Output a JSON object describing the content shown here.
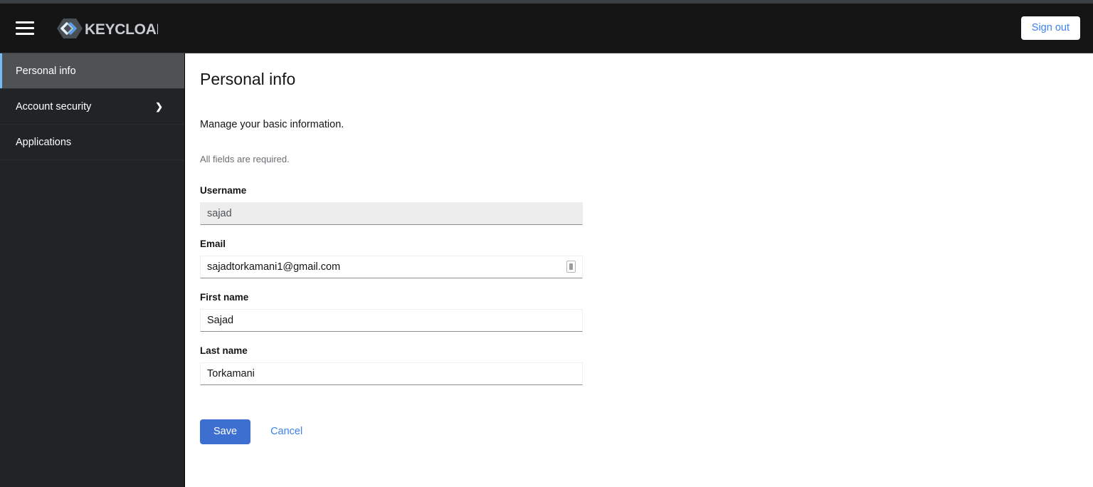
{
  "brand": {
    "name": "KEYCLOAK",
    "logo_hex_color": "#4a4f54",
    "logo_chevron_color": "#57a0e8",
    "logo_chevron_light": "#e8f3fc"
  },
  "masthead": {
    "menu_icon": "hamburger-icon",
    "sign_out_label": "Sign out",
    "background": "#151515",
    "sign_out_text_color": "#3c82f0"
  },
  "sidebar": {
    "background": "#212427",
    "active_background": "#4f5255",
    "active_accent": "#73bcf7",
    "items": [
      {
        "label": "Personal info",
        "active": true,
        "has_chevron": false
      },
      {
        "label": "Account security",
        "active": false,
        "has_chevron": true,
        "chevron": "❯"
      },
      {
        "label": "Applications",
        "active": false,
        "has_chevron": false
      }
    ]
  },
  "main": {
    "title": "Personal info",
    "subtitle": "Manage your basic information.",
    "required_note": "All fields are required.",
    "fields": [
      {
        "label": "Username",
        "value": "sajad",
        "placeholder": "",
        "disabled": true,
        "has_autofill_icon": false
      },
      {
        "label": "Email",
        "value": "sajadtorkamani1@gmail.com",
        "placeholder": "",
        "disabled": false,
        "has_autofill_icon": true
      },
      {
        "label": "First name",
        "value": "Sajad",
        "placeholder": "",
        "disabled": false,
        "has_autofill_icon": false
      },
      {
        "label": "Last name",
        "value": "Torkamani",
        "placeholder": "",
        "disabled": false,
        "has_autofill_icon": false
      }
    ],
    "save_label": "Save",
    "cancel_label": "Cancel",
    "save_color": "#3c6fd0",
    "cancel_color": "#3c82f0"
  }
}
